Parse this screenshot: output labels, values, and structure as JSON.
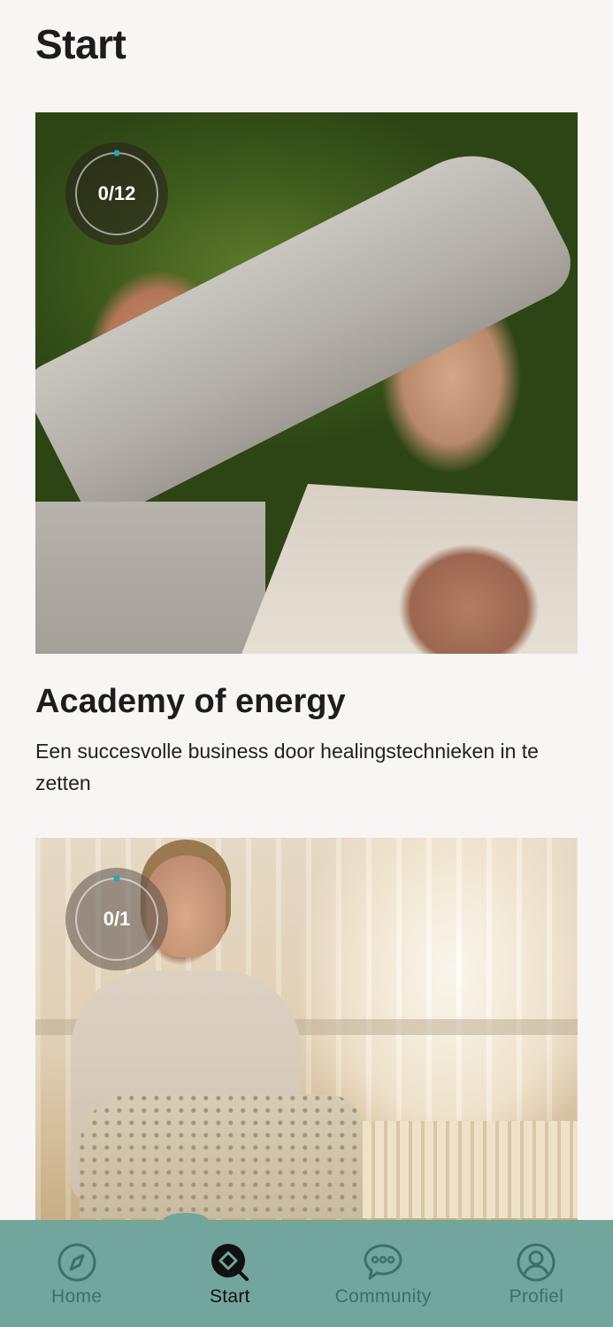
{
  "page": {
    "title": "Start"
  },
  "courses": [
    {
      "progress_text": "0/12",
      "progress_fraction": 0,
      "title": "Academy of energy",
      "description": "Een succesvolle business door healingstechnieken in te zetten"
    },
    {
      "progress_text": "0/1",
      "progress_fraction": 0
    }
  ],
  "nav": {
    "items": [
      {
        "label": "Home",
        "icon": "compass-icon",
        "active": false
      },
      {
        "label": "Start",
        "icon": "diamond-search-icon",
        "active": true
      },
      {
        "label": "Community",
        "icon": "chat-bubble-icon",
        "active": false
      },
      {
        "label": "Profiel",
        "icon": "user-icon",
        "active": false
      }
    ]
  },
  "colors": {
    "background": "#f8f5f4",
    "nav_background": "#72a59c",
    "nav_inactive": "#3f6f67",
    "nav_active": "#111111",
    "progress_accent": "#2aa5b5"
  }
}
